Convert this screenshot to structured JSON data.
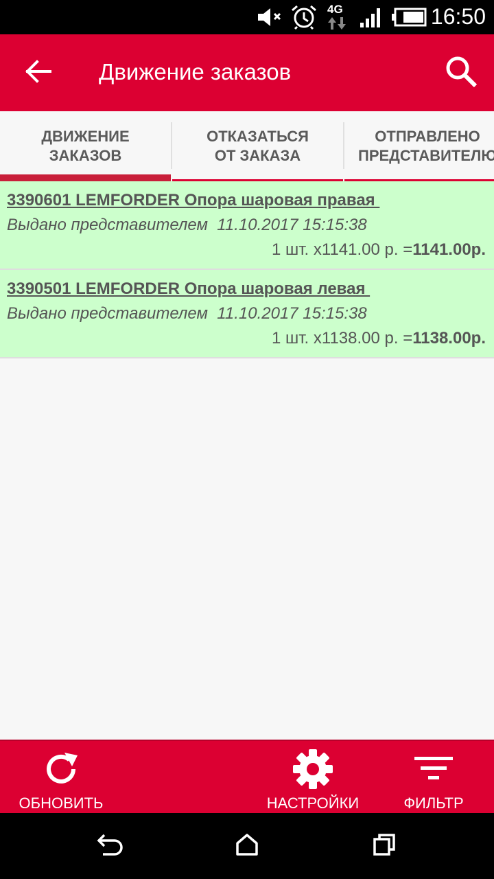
{
  "status_bar": {
    "time": "16:50",
    "network": "4G",
    "icons": [
      "mute-icon",
      "alarm-icon",
      "network-4g-icon",
      "signal-icon",
      "battery-icon"
    ]
  },
  "app_bar": {
    "title": "Движение заказов",
    "background": "#dc0032",
    "back_icon": "arrow-back-icon",
    "search_icon": "search-icon"
  },
  "tabs": [
    {
      "label": "ДВИЖЕНИЕ\nЗАКАЗОВ",
      "active": true
    },
    {
      "label": "ОТКАЗАТЬСЯ\nОТ ЗАКАЗА",
      "active": false
    },
    {
      "label": "ОТПРАВЛЕНО\nПРЕДСТАВИТЕЛЮ",
      "active": false
    }
  ],
  "orders": [
    {
      "title": "3390601 LEMFORDER Опора шаровая правая ",
      "status": "Выдано представителем  11.10.2017 15:15:38",
      "qty_price": "1 шт. x1141.00 р. =",
      "total": "1141.00р."
    },
    {
      "title": "3390501 LEMFORDER Опора шаровая левая ",
      "status": "Выдано представителем  11.10.2017 15:15:38",
      "qty_price": "1 шт. x1138.00 р. =",
      "total": "1138.00р."
    }
  ],
  "bottom_bar": {
    "refresh_label": "ОБНОВИТЬ",
    "settings_label": "НАСТРОЙКИ",
    "filter_label": "ФИЛЬТР",
    "background": "#dc0032"
  },
  "nav_bar": {
    "icons": [
      "nav-back-icon",
      "nav-home-icon",
      "nav-recents-icon"
    ]
  }
}
